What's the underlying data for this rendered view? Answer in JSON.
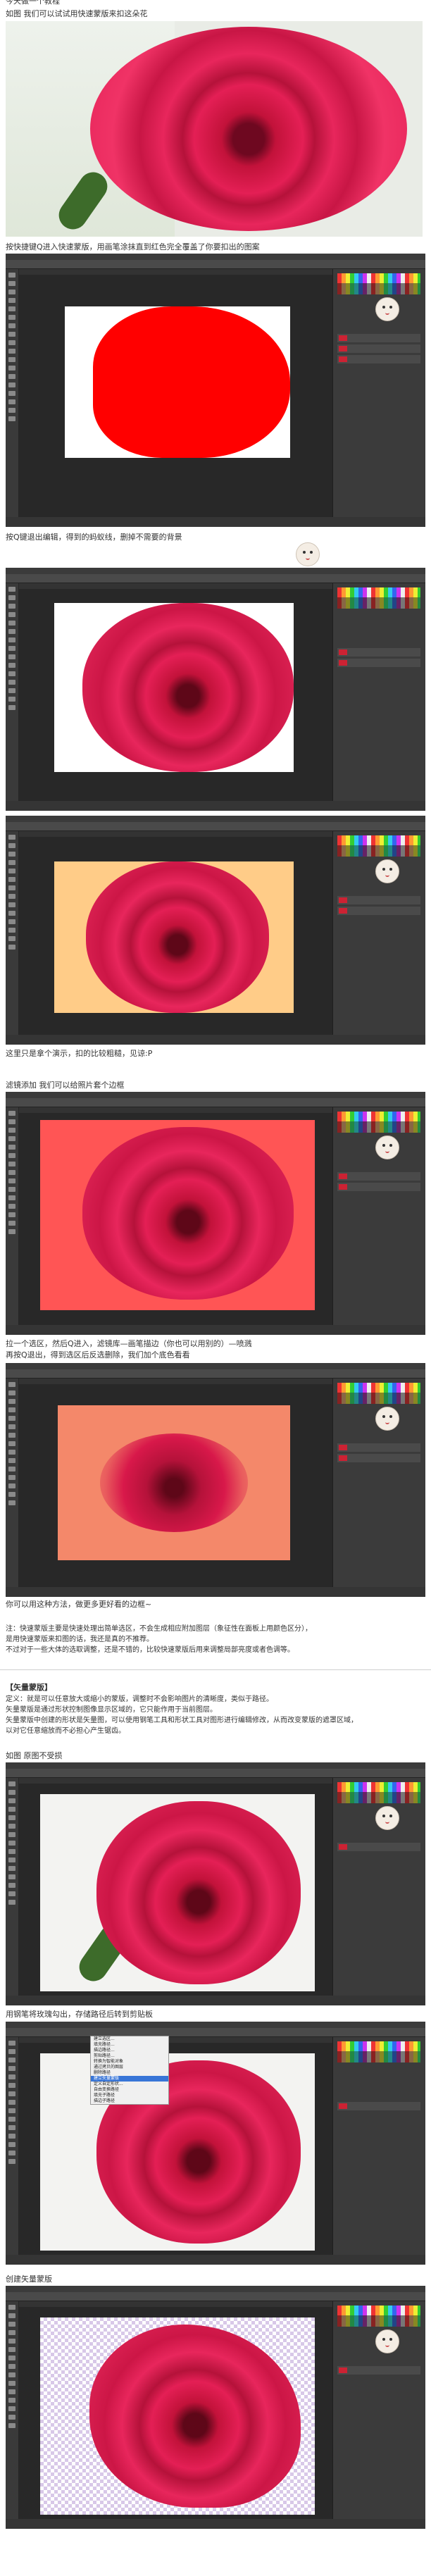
{
  "texts": {
    "top_partial": "今天做一个教程",
    "s1": "如图 我们可以试试用快速蒙版来扣这朵花",
    "s2": "按快捷键Q进入快速蒙版，用画笔涂抹直到红色完全覆盖了你要扣出的图案",
    "s3": "按Q键退出编辑，得到的蚂蚁线，删掉不需要的背景",
    "s4": "这里只是拿个演示，扣的比较粗糙，见谅:P",
    "s5": "滤镜添加 我们可以给照片套个边框",
    "s6a": "拉一个选区，然后Q进入，滤镜库—画笔描边（你也可以用别的）—喷溅",
    "s6b": "再按Q退出，得到选区后反选删除，我们加个底色看看",
    "s7": "你可以用这种方法，做更多更好看的边框~",
    "note1": "注：快速蒙版主要是快速处理出简单选区，不会生成相应附加图层（象征性在面板上用颜色区分），",
    "note2": "是用快速蒙版来扣图的话，我还是真的不推荐。",
    "note3": "不过对于一些大体的选取调整，还是不错的，比较快速蒙版后用来调整局部亮度或者色调等。",
    "vec_title": "【矢量蒙版】",
    "vec1": "定义：就是可以任意放大或缩小的蒙版，调整时不会影响图片的清晰度，类似于路径。",
    "vec2": "矢量蒙版是通过形状控制图像显示区域的，它只能作用于当前图层。",
    "vec3": "矢量蒙版中创建的形状是矢量图，可以使用钢笔工具和形状工具对图形进行编辑修改，从而改变蒙版的遮罩区域，",
    "vec4": "以对它任意缩放而不必担心产生锯齿。",
    "s8": "如图 原图不受损",
    "s9": "用钢笔将玫瑰勾出，存储路径后转到剪贴板",
    "s10": "创建矢量蒙版"
  },
  "menu_items": [
    "建立选区...",
    "填充路径...",
    "描边路径...",
    "剪贴路径...",
    "转换为智能对象",
    "通过拷贝的图层",
    "删除路径",
    "建立矢量蒙版",
    "定义自定形状...",
    "自由变换路径",
    "填充子路径",
    "描边子路径"
  ],
  "colors": {
    "rose": "#d8184a",
    "mask_red": "#ff0000",
    "peach": "#ffcc88",
    "salmon": "#f4886a",
    "ps_bg": "#262626"
  }
}
